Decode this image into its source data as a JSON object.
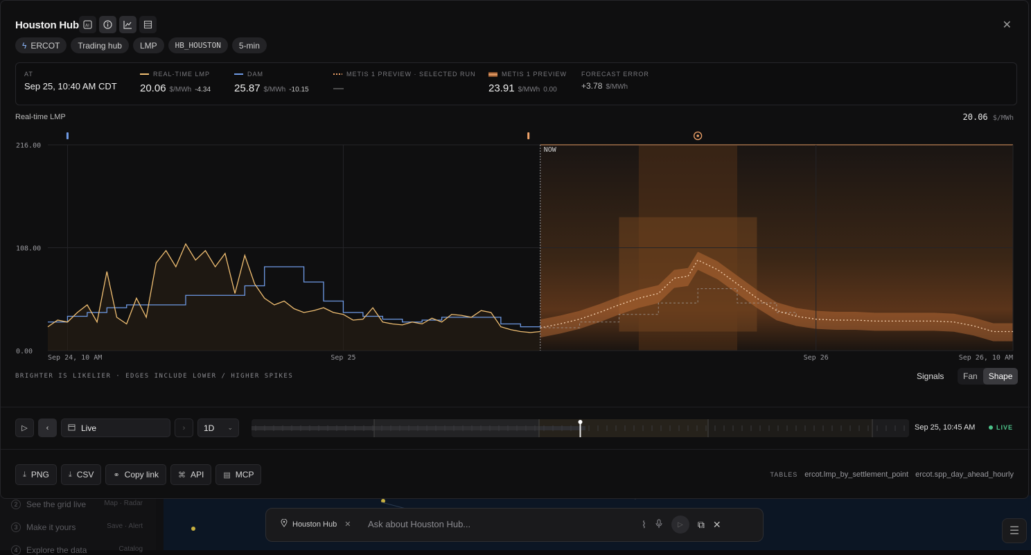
{
  "background": {
    "steps": [
      {
        "num": "2",
        "label": "See the grid live",
        "sub": "Map · Radar"
      },
      {
        "num": "3",
        "label": "Make it yours",
        "sub": "Save · Alert"
      },
      {
        "num": "4",
        "label": "Explore the data",
        "sub": "Catalog"
      }
    ]
  },
  "header": {
    "title": "Houston Hub",
    "icons": [
      "ai-icon",
      "info-icon",
      "chart-icon",
      "table-icon"
    ],
    "close_icon": "close-icon"
  },
  "tags": [
    "ERCOT",
    "Trading hub",
    "LMP",
    "HB_HOUSTON",
    "5-min"
  ],
  "stats": {
    "at": {
      "label": "AT",
      "value": "Sep 25, 10:40 AM CDT"
    },
    "rt": {
      "label": "REAL-TIME LMP",
      "value": "20.06",
      "unit": "$/MWh",
      "delta": "-4.34",
      "color": "#f2c073"
    },
    "dam": {
      "label": "DAM",
      "value": "25.87",
      "unit": "$/MWh",
      "delta": "-10.15",
      "color": "#6f9be6"
    },
    "metis_run": {
      "label": "METIS 1 PREVIEW · SELECTED RUN",
      "value": "—",
      "color": "#f0a36a"
    },
    "metis": {
      "label": "METIS 1 PREVIEW",
      "value": "23.91",
      "unit": "$/MWh",
      "delta": "0.00",
      "color": "#f0a36a"
    },
    "error": {
      "label": "FORECAST ERROR",
      "value": "+3.78",
      "unit": "$/MWh"
    }
  },
  "chart_header": {
    "label": "Real-time LMP",
    "readout_value": "20.06",
    "readout_unit": "$/MWh"
  },
  "chart_data": {
    "type": "line",
    "ylim": [
      0,
      216
    ],
    "yticks": [
      "216.00",
      "108.00",
      "0.00"
    ],
    "xticks": [
      "Sep 24, 10 AM",
      "Sep 25",
      "Sep 26",
      "Sep 26, 10 AM"
    ],
    "now_label": "NOW",
    "x_hours_range": [
      -25,
      24
    ],
    "series": [
      {
        "name": "Real-time LMP",
        "color": "#f2c073",
        "x": [
          -25,
          -24.5,
          -24,
          -23.5,
          -23,
          -22.5,
          -22,
          -21.5,
          -21,
          -20.5,
          -20,
          -19.5,
          -19,
          -18.5,
          -18,
          -17.5,
          -17,
          -16.5,
          -16,
          -15.5,
          -15,
          -14.5,
          -14,
          -13.5,
          -13,
          -12.5,
          -12,
          -11.5,
          -11,
          -10.5,
          -10,
          -9.5,
          -9,
          -8.5,
          -8,
          -7.5,
          -7,
          -6.5,
          -6,
          -5.5,
          -5,
          -4.5,
          -4,
          -3.5,
          -3,
          -2.5,
          -2,
          -1.5,
          -1,
          -0.5,
          0
        ],
        "values": [
          25,
          32,
          30,
          40,
          48,
          30,
          83,
          35,
          28,
          55,
          35,
          92,
          105,
          88,
          112,
          95,
          105,
          88,
          102,
          60,
          100,
          70,
          55,
          48,
          52,
          44,
          40,
          42,
          45,
          40,
          38,
          32,
          33,
          45,
          30,
          28,
          27,
          30,
          28,
          34,
          30,
          38,
          37,
          35,
          42,
          40,
          25,
          22,
          20,
          19,
          20
        ]
      },
      {
        "name": "DAM",
        "color": "#6f9be6",
        "x": [
          -25,
          -24,
          -23,
          -22,
          -21,
          -20,
          -19,
          -18,
          -17,
          -16,
          -15,
          -14,
          -13,
          -12,
          -11,
          -10,
          -9,
          -8,
          -7,
          -6,
          -5,
          -4,
          -3,
          -2,
          -1,
          0
        ],
        "values": [
          30,
          36,
          40,
          45,
          48,
          48,
          48,
          58,
          58,
          58,
          68,
          88,
          88,
          72,
          52,
          40,
          36,
          33,
          30,
          32,
          35,
          35,
          35,
          28,
          25,
          26
        ]
      },
      {
        "name": "Metis 1 Preview",
        "color": "#f6b586",
        "x": [
          0,
          1,
          2,
          3,
          4,
          5,
          6,
          6.8,
          7.5,
          8,
          9,
          10,
          11,
          12,
          13,
          14,
          15,
          16,
          17,
          18,
          19,
          20,
          21,
          22,
          23,
          24
        ],
        "values": [
          23.91,
          28,
          33,
          40,
          48,
          55,
          60,
          76,
          78,
          95,
          85,
          70,
          55,
          42,
          36,
          33,
          32,
          32,
          31,
          31,
          31,
          31,
          30,
          26,
          20,
          20
        ]
      },
      {
        "name": "Selected run",
        "color": "#a9a9a9",
        "x": [
          0,
          2,
          4,
          6,
          7,
          8,
          9,
          10,
          11,
          12,
          13
        ],
        "values": [
          24,
          30,
          38,
          50,
          50,
          65,
          65,
          50,
          50,
          40,
          35
        ]
      }
    ]
  },
  "chart_note": "BRIGHTER IS LIKELIER · EDGES INCLUDE LOWER / HIGHER SPIKES",
  "toggles": {
    "signals": "Signals",
    "fan": "Fan",
    "shape": "Shape"
  },
  "playback": {
    "mode": "Live",
    "range": "1D",
    "time": "Sep 25, 10:45 AM",
    "live": "LIVE",
    "progress": 0.5
  },
  "actions": [
    {
      "label": "PNG",
      "icon": "download-icon"
    },
    {
      "label": "CSV",
      "icon": "download-icon"
    },
    {
      "label": "Copy link",
      "icon": "link-icon"
    },
    {
      "label": "API",
      "icon": "api-icon"
    },
    {
      "label": "MCP",
      "icon": "mcp-icon"
    }
  ],
  "tables": {
    "label": "TABLES",
    "items": [
      "ercot.lmp_by_settlement_point",
      "ercot.spp_day_ahead_hourly"
    ]
  },
  "ask": {
    "chip": "Houston Hub",
    "placeholder": "Ask about Houston Hub..."
  }
}
